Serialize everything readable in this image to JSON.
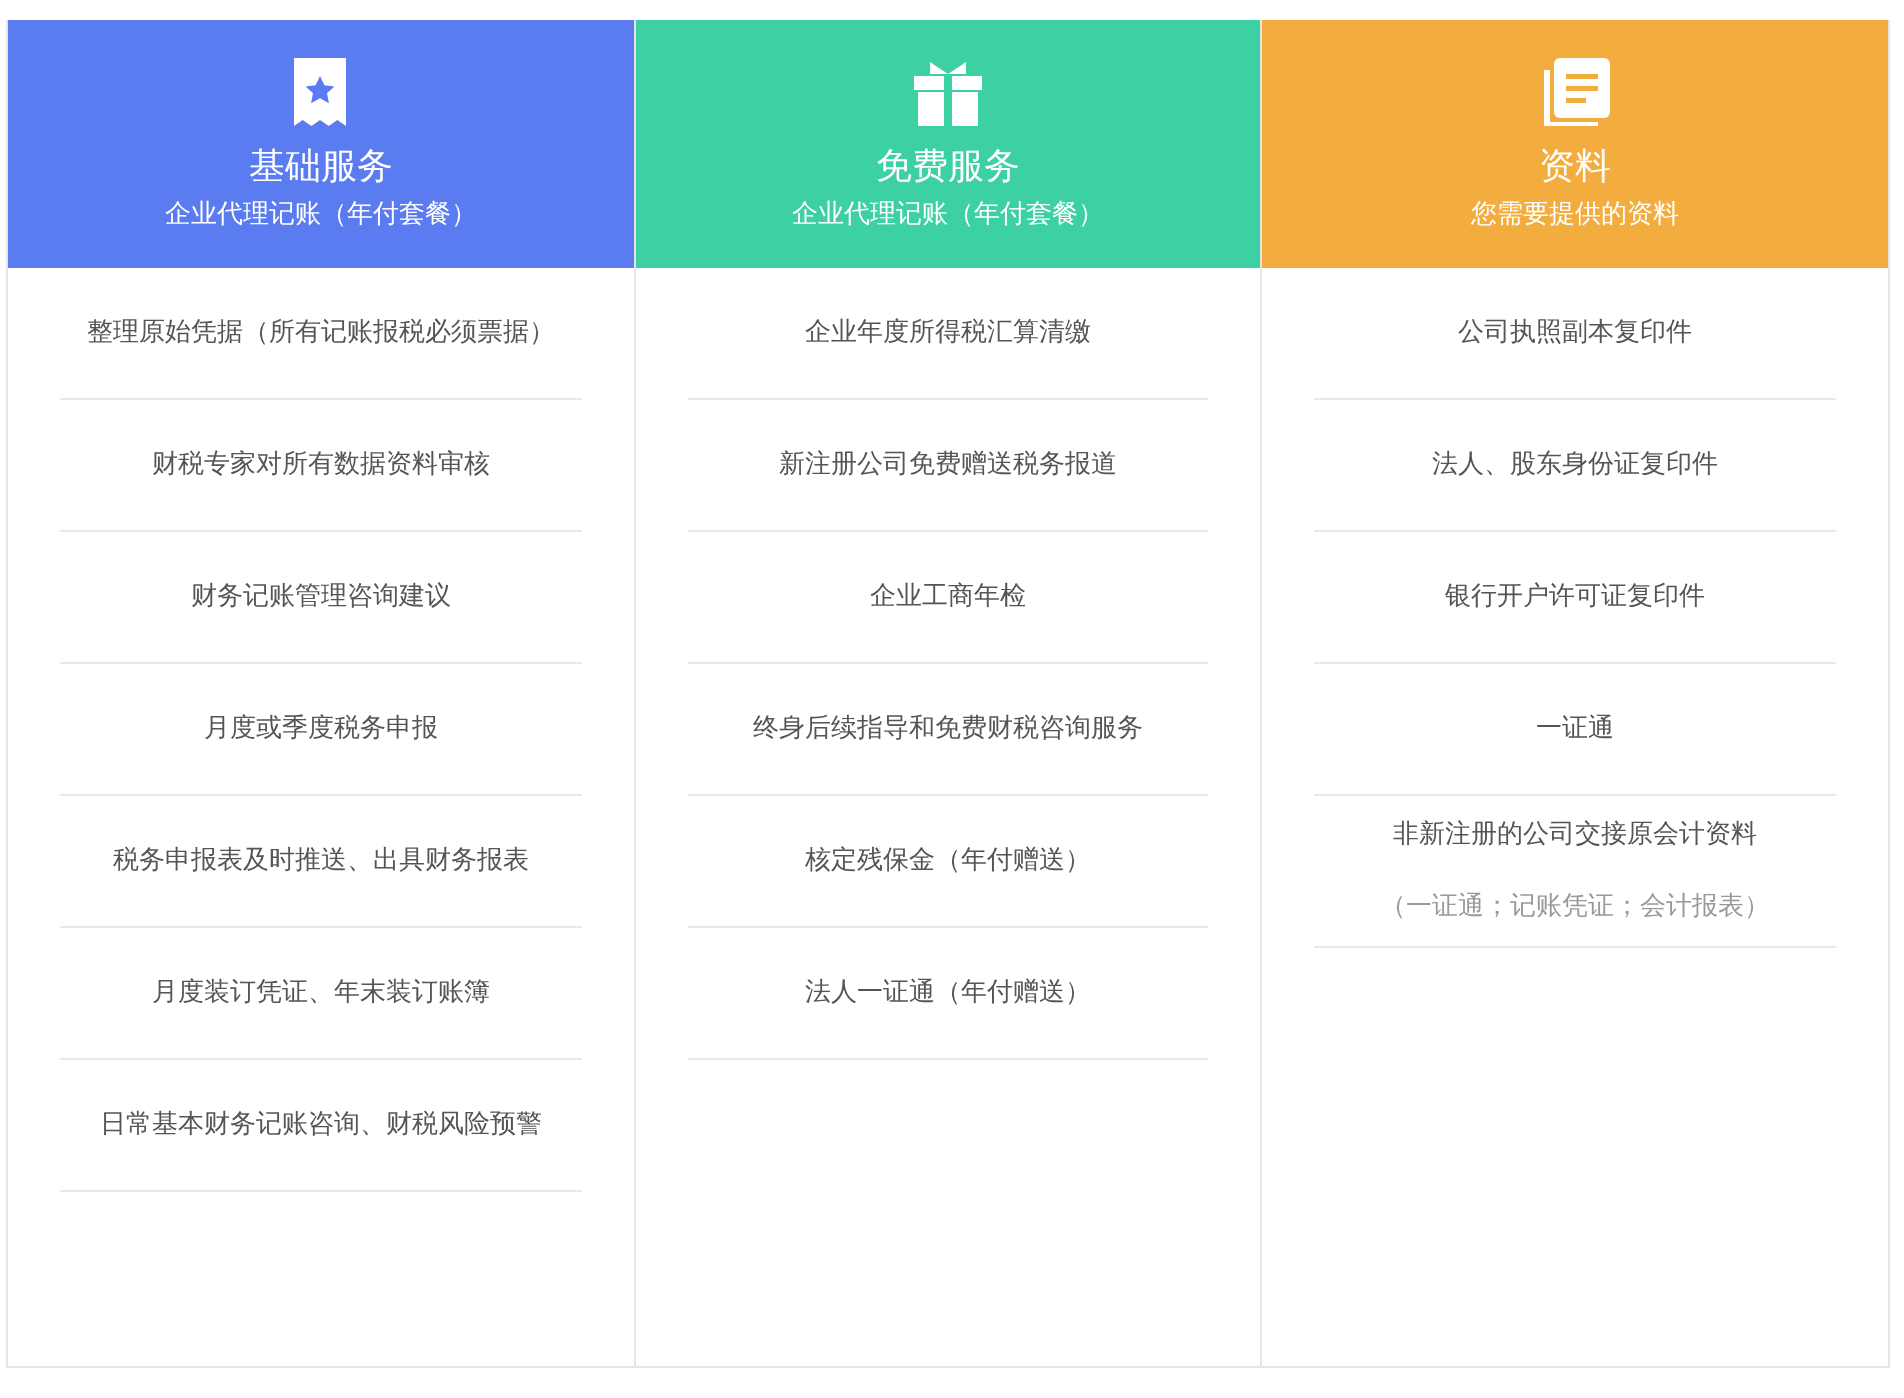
{
  "columns": [
    {
      "kind": "star",
      "color": "#5b7bf0",
      "title": "基础服务",
      "subtitle": "企业代理记账（年付套餐）",
      "items": [
        {
          "text": "整理原始凭据（所有记账报税必须票据）"
        },
        {
          "text": "财税专家对所有数据资料审核"
        },
        {
          "text": "财务记账管理咨询建议"
        },
        {
          "text": "月度或季度税务申报"
        },
        {
          "text": "税务申报表及时推送、出具财务报表"
        },
        {
          "text": "月度装订凭证、年末装订账簿"
        },
        {
          "text": "日常基本财务记账咨询、财税风险预警"
        }
      ]
    },
    {
      "kind": "gift",
      "color": "#3dd0a3",
      "title": "免费服务",
      "subtitle": "企业代理记账（年付套餐）",
      "items": [
        {
          "text": "企业年度所得税汇算清缴"
        },
        {
          "text": "新注册公司免费赠送税务报道"
        },
        {
          "text": "企业工商年检"
        },
        {
          "text": "终身后续指导和免费财税咨询服务"
        },
        {
          "text": "核定残保金（年付赠送）"
        },
        {
          "text": "法人一证通（年付赠送）"
        }
      ]
    },
    {
      "kind": "document",
      "color": "#f2ad3e",
      "title": "资料",
      "subtitle": "您需要提供的资料",
      "items": [
        {
          "text": "公司执照副本复印件"
        },
        {
          "text": "法人、股东身份证复印件"
        },
        {
          "text": "银行开户许可证复印件"
        },
        {
          "text": "一证通"
        },
        {
          "text": "非新注册的公司交接原会计资料",
          "note": "（一证通；记账凭证；会计报表）"
        }
      ]
    }
  ]
}
